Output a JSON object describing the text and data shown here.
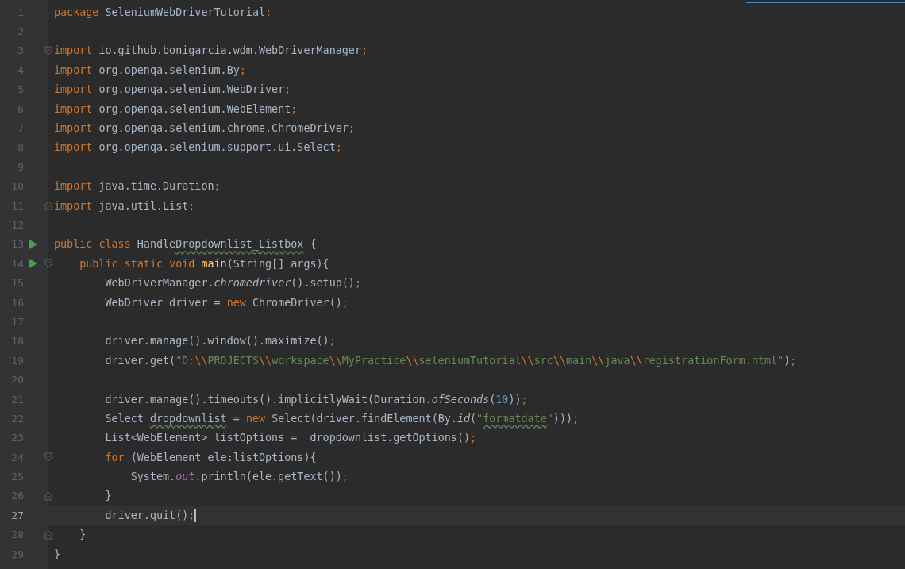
{
  "editor": {
    "lines": [
      {
        "number": "1",
        "tokens": [
          {
            "kind": "keyword",
            "text": "package "
          },
          {
            "kind": "plain",
            "text": "SeleniumWebDriverTutorial"
          },
          {
            "kind": "semicolon",
            "text": ";"
          }
        ]
      },
      {
        "number": "2"
      },
      {
        "number": "3",
        "fold_start": true,
        "tokens": [
          {
            "kind": "keyword",
            "text": "import "
          },
          {
            "kind": "plain",
            "text": "io.github.bonigarcia.wdm.WebDriverManager"
          },
          {
            "kind": "semicolon",
            "text": ";"
          }
        ]
      },
      {
        "number": "4",
        "tokens": [
          {
            "kind": "keyword",
            "text": "import "
          },
          {
            "kind": "plain",
            "text": "org.openqa.selenium.By"
          },
          {
            "kind": "semicolon",
            "text": ";"
          }
        ]
      },
      {
        "number": "5",
        "tokens": [
          {
            "kind": "keyword",
            "text": "import "
          },
          {
            "kind": "plain",
            "text": "org.openqa.selenium.WebDriver"
          },
          {
            "kind": "semicolon",
            "text": ";"
          }
        ]
      },
      {
        "number": "6",
        "tokens": [
          {
            "kind": "keyword",
            "text": "import "
          },
          {
            "kind": "plain",
            "text": "org.openqa.selenium.WebElement"
          },
          {
            "kind": "semicolon",
            "text": ";"
          }
        ]
      },
      {
        "number": "7",
        "tokens": [
          {
            "kind": "keyword",
            "text": "import "
          },
          {
            "kind": "plain",
            "text": "org.openqa.selenium.chrome.ChromeDriver"
          },
          {
            "kind": "semicolon",
            "text": ";"
          }
        ]
      },
      {
        "number": "8",
        "tokens": [
          {
            "kind": "keyword",
            "text": "import "
          },
          {
            "kind": "plain",
            "text": "org.openqa.selenium.support.ui.Select"
          },
          {
            "kind": "semicolon",
            "text": ";"
          }
        ]
      },
      {
        "number": "9"
      },
      {
        "number": "10",
        "tokens": [
          {
            "kind": "keyword",
            "text": "import "
          },
          {
            "kind": "plain",
            "text": "java.time.Duration"
          },
          {
            "kind": "semicolon",
            "text": ";"
          }
        ]
      },
      {
        "number": "11",
        "fold_end": true,
        "tokens": [
          {
            "kind": "keyword",
            "text": "import "
          },
          {
            "kind": "plain",
            "text": "java.util.List"
          },
          {
            "kind": "semicolon",
            "text": ";"
          }
        ]
      },
      {
        "number": "12"
      },
      {
        "number": "13",
        "runnable": true,
        "tokens": [
          {
            "kind": "keyword",
            "text": "public class "
          },
          {
            "kind": "plain",
            "text": "Handle"
          },
          {
            "kind": "plain",
            "text": "Dropdownlist_Listbox",
            "warning": true
          },
          {
            "kind": "plain",
            "text": " {"
          }
        ]
      },
      {
        "number": "14",
        "runnable": true,
        "fold_start": true,
        "tokens": [
          {
            "kind": "keyword",
            "text": "    public static void "
          },
          {
            "kind": "declaration",
            "text": "main"
          },
          {
            "kind": "plain",
            "text": "(String[] args){"
          }
        ]
      },
      {
        "number": "15",
        "tokens": [
          {
            "kind": "plain",
            "text": "        WebDriverManager."
          },
          {
            "kind": "static",
            "text": "chromedriver"
          },
          {
            "kind": "plain",
            "text": "().setup()"
          },
          {
            "kind": "semicolon",
            "text": ";"
          }
        ]
      },
      {
        "number": "16",
        "tokens": [
          {
            "kind": "plain",
            "text": "        WebDriver driver = "
          },
          {
            "kind": "keyword",
            "text": "new "
          },
          {
            "kind": "plain",
            "text": "ChromeDriver()"
          },
          {
            "kind": "semicolon",
            "text": ";"
          }
        ]
      },
      {
        "number": "17"
      },
      {
        "number": "18",
        "tokens": [
          {
            "kind": "plain",
            "text": "        driver.manage().window().maximize()"
          },
          {
            "kind": "semicolon",
            "text": ";"
          }
        ]
      },
      {
        "number": "19",
        "tokens": [
          {
            "kind": "plain",
            "text": "        driver.get("
          },
          {
            "kind": "string",
            "text": "\"D:"
          },
          {
            "kind": "escape",
            "text": "\\\\"
          },
          {
            "kind": "string",
            "text": "PROJECTS"
          },
          {
            "kind": "escape",
            "text": "\\\\"
          },
          {
            "kind": "string",
            "text": "workspace"
          },
          {
            "kind": "escape",
            "text": "\\\\"
          },
          {
            "kind": "string",
            "text": "MyPractice"
          },
          {
            "kind": "escape",
            "text": "\\\\"
          },
          {
            "kind": "string",
            "text": "seleniumTutorial"
          },
          {
            "kind": "escape",
            "text": "\\\\"
          },
          {
            "kind": "string",
            "text": "src"
          },
          {
            "kind": "escape",
            "text": "\\\\"
          },
          {
            "kind": "string",
            "text": "main"
          },
          {
            "kind": "escape",
            "text": "\\\\"
          },
          {
            "kind": "string",
            "text": "java"
          },
          {
            "kind": "escape",
            "text": "\\\\"
          },
          {
            "kind": "string",
            "text": "registrationForm.html\""
          },
          {
            "kind": "plain",
            "text": ")"
          },
          {
            "kind": "semicolon",
            "text": ";"
          }
        ]
      },
      {
        "number": "20"
      },
      {
        "number": "21",
        "tokens": [
          {
            "kind": "plain",
            "text": "        driver.manage().timeouts().implicitlyWait(Duration."
          },
          {
            "kind": "static",
            "text": "ofSeconds"
          },
          {
            "kind": "plain",
            "text": "("
          },
          {
            "kind": "number",
            "text": "10"
          },
          {
            "kind": "plain",
            "text": "))"
          },
          {
            "kind": "semicolon",
            "text": ";"
          }
        ]
      },
      {
        "number": "22",
        "tokens": [
          {
            "kind": "plain",
            "text": "        Select "
          },
          {
            "kind": "plain",
            "text": "dropdownlist",
            "warning": true
          },
          {
            "kind": "plain",
            "text": " = "
          },
          {
            "kind": "keyword",
            "text": "new "
          },
          {
            "kind": "plain",
            "text": "Select(driver.findElement(By."
          },
          {
            "kind": "static",
            "text": "id"
          },
          {
            "kind": "plain",
            "text": "("
          },
          {
            "kind": "string",
            "text": "\""
          },
          {
            "kind": "string",
            "text": "formatdate",
            "warning": true
          },
          {
            "kind": "string",
            "text": "\""
          },
          {
            "kind": "plain",
            "text": ")))"
          },
          {
            "kind": "semicolon",
            "text": ";"
          }
        ]
      },
      {
        "number": "23",
        "tokens": [
          {
            "kind": "plain",
            "text": "        List<WebElement> listOptions =  dropdownlist.getOptions()"
          },
          {
            "kind": "semicolon",
            "text": ";"
          }
        ]
      },
      {
        "number": "24",
        "fold_start": true,
        "tokens": [
          {
            "kind": "keyword",
            "text": "        for "
          },
          {
            "kind": "plain",
            "text": "(WebElement ele:listOptions){"
          }
        ]
      },
      {
        "number": "25",
        "tokens": [
          {
            "kind": "plain",
            "text": "            System."
          },
          {
            "kind": "field",
            "text": "out"
          },
          {
            "kind": "plain",
            "text": ".println(ele.getText())"
          },
          {
            "kind": "semicolon",
            "text": ";"
          }
        ]
      },
      {
        "number": "26",
        "fold_end": true,
        "tokens": [
          {
            "kind": "plain",
            "text": "        }"
          }
        ]
      },
      {
        "number": "27",
        "current": true,
        "tokens": [
          {
            "kind": "plain",
            "text": "        driver.quit()"
          },
          {
            "kind": "semicolon",
            "text": ";"
          }
        ]
      },
      {
        "number": "28",
        "fold_end": true,
        "tokens": [
          {
            "kind": "plain",
            "text": "    }"
          }
        ]
      },
      {
        "number": "29",
        "tokens": [
          {
            "kind": "plain",
            "text": "}"
          }
        ]
      }
    ]
  }
}
